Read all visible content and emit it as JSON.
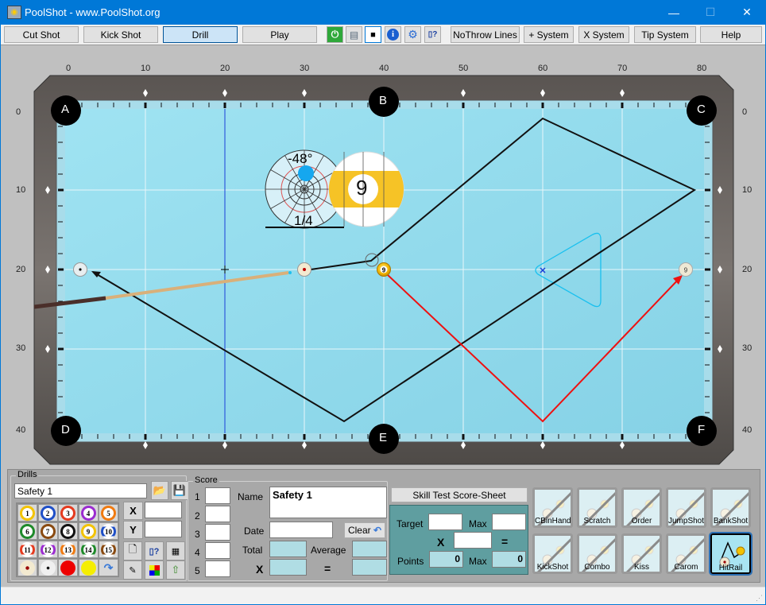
{
  "window": {
    "title": "PoolShot - www.PoolShot.org",
    "controls": {
      "minimize": "—",
      "maximize": "☐",
      "close": "✕"
    }
  },
  "toolbar": {
    "mode_buttons": [
      {
        "label": "Cut Shot",
        "active": false
      },
      {
        "label": "Kick Shot",
        "active": false
      },
      {
        "label": "Drill",
        "active": true
      },
      {
        "label": "Play",
        "active": false
      }
    ],
    "icon_buttons": [
      {
        "icon": "power-icon",
        "glyph": "⏻"
      },
      {
        "icon": "printer-icon",
        "glyph": "🖶"
      },
      {
        "icon": "camera-icon",
        "glyph": "📷"
      },
      {
        "icon": "info-icon",
        "glyph": "i"
      },
      {
        "icon": "gear-icon",
        "glyph": "⚙"
      },
      {
        "icon": "help-document-icon",
        "glyph": "?"
      }
    ],
    "right_buttons": [
      "NoThrow Lines",
      "+ System",
      "X System",
      "Tip System",
      "Help"
    ]
  },
  "table": {
    "x_ticks": [
      "0",
      "10",
      "20",
      "30",
      "40",
      "50",
      "60",
      "70",
      "80"
    ],
    "y_ticks": [
      "0",
      "10",
      "20",
      "30",
      "40"
    ],
    "pockets": [
      "A",
      "B",
      "C",
      "D",
      "E",
      "F"
    ],
    "spin_indicator": {
      "angle": "-48°",
      "fraction": "1/4"
    },
    "object_ball_number": "9",
    "colors": {
      "felt": "#94dcee",
      "shot_path": "#000000",
      "object_path": "#ff0000",
      "rack": "#19c0ef",
      "aim_line": "#1a3fd8"
    }
  },
  "drills": {
    "label": "Drills",
    "name_value": "Safety 1",
    "balls": [
      "1",
      "2",
      "3",
      "4",
      "5",
      "6",
      "7",
      "8",
      "9",
      "10",
      "11",
      "12",
      "13",
      "14",
      "15"
    ],
    "extra_balls": [
      "cue-red-dot",
      "cue-black-dot",
      "red",
      "yellow",
      "rotate"
    ],
    "x_label": "X",
    "y_label": "Y",
    "x_value": "",
    "y_value": ""
  },
  "score": {
    "label": "Score",
    "rows": [
      "1",
      "2",
      "3",
      "4",
      "5"
    ],
    "name_label": "Name",
    "name_value": "Safety 1",
    "date_label": "Date",
    "date_value": "",
    "clear_label": "Clear",
    "total_label": "Total",
    "average_label": "Average",
    "x_label": "X",
    "eq_label": "="
  },
  "skill_test": {
    "title": "Skill Test Score-Sheet",
    "target_label": "Target",
    "max_label": "Max",
    "x_label": "X",
    "eq_label": "=",
    "points_label": "Points",
    "points_value": "0",
    "max2_label": "Max",
    "max2_value": "0"
  },
  "shot_types": [
    {
      "label": "CBinHand",
      "selected": false
    },
    {
      "label": "Scratch",
      "selected": false
    },
    {
      "label": "Order",
      "selected": false
    },
    {
      "label": "JumpShot",
      "selected": false
    },
    {
      "label": "BankShot",
      "selected": false
    },
    {
      "label": "KickShot",
      "selected": false
    },
    {
      "label": "Combo",
      "selected": false
    },
    {
      "label": "Kiss",
      "selected": false
    },
    {
      "label": "Carom",
      "selected": false
    },
    {
      "label": "HitRail",
      "selected": true
    }
  ]
}
